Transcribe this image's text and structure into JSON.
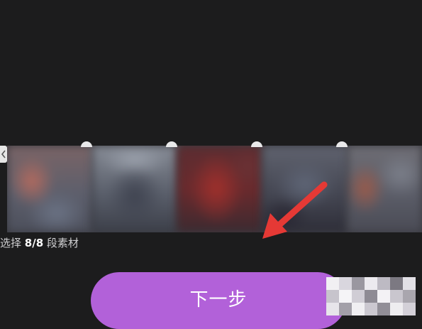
{
  "selection": {
    "prefix": "选择 ",
    "count": "8/8",
    "suffix": " 段素材"
  },
  "actions": {
    "next_label": "下一步"
  },
  "colors": {
    "background": "#1c1c1d",
    "button": "#b261d9",
    "arrow": "#e53935"
  },
  "icons": {
    "left_handle": "chevron-left-icon",
    "annotation": "red-arrow-icon"
  },
  "clips": [
    {
      "name": "clip-1"
    },
    {
      "name": "clip-2"
    },
    {
      "name": "clip-3"
    },
    {
      "name": "clip-4"
    },
    {
      "name": "clip-5"
    }
  ]
}
